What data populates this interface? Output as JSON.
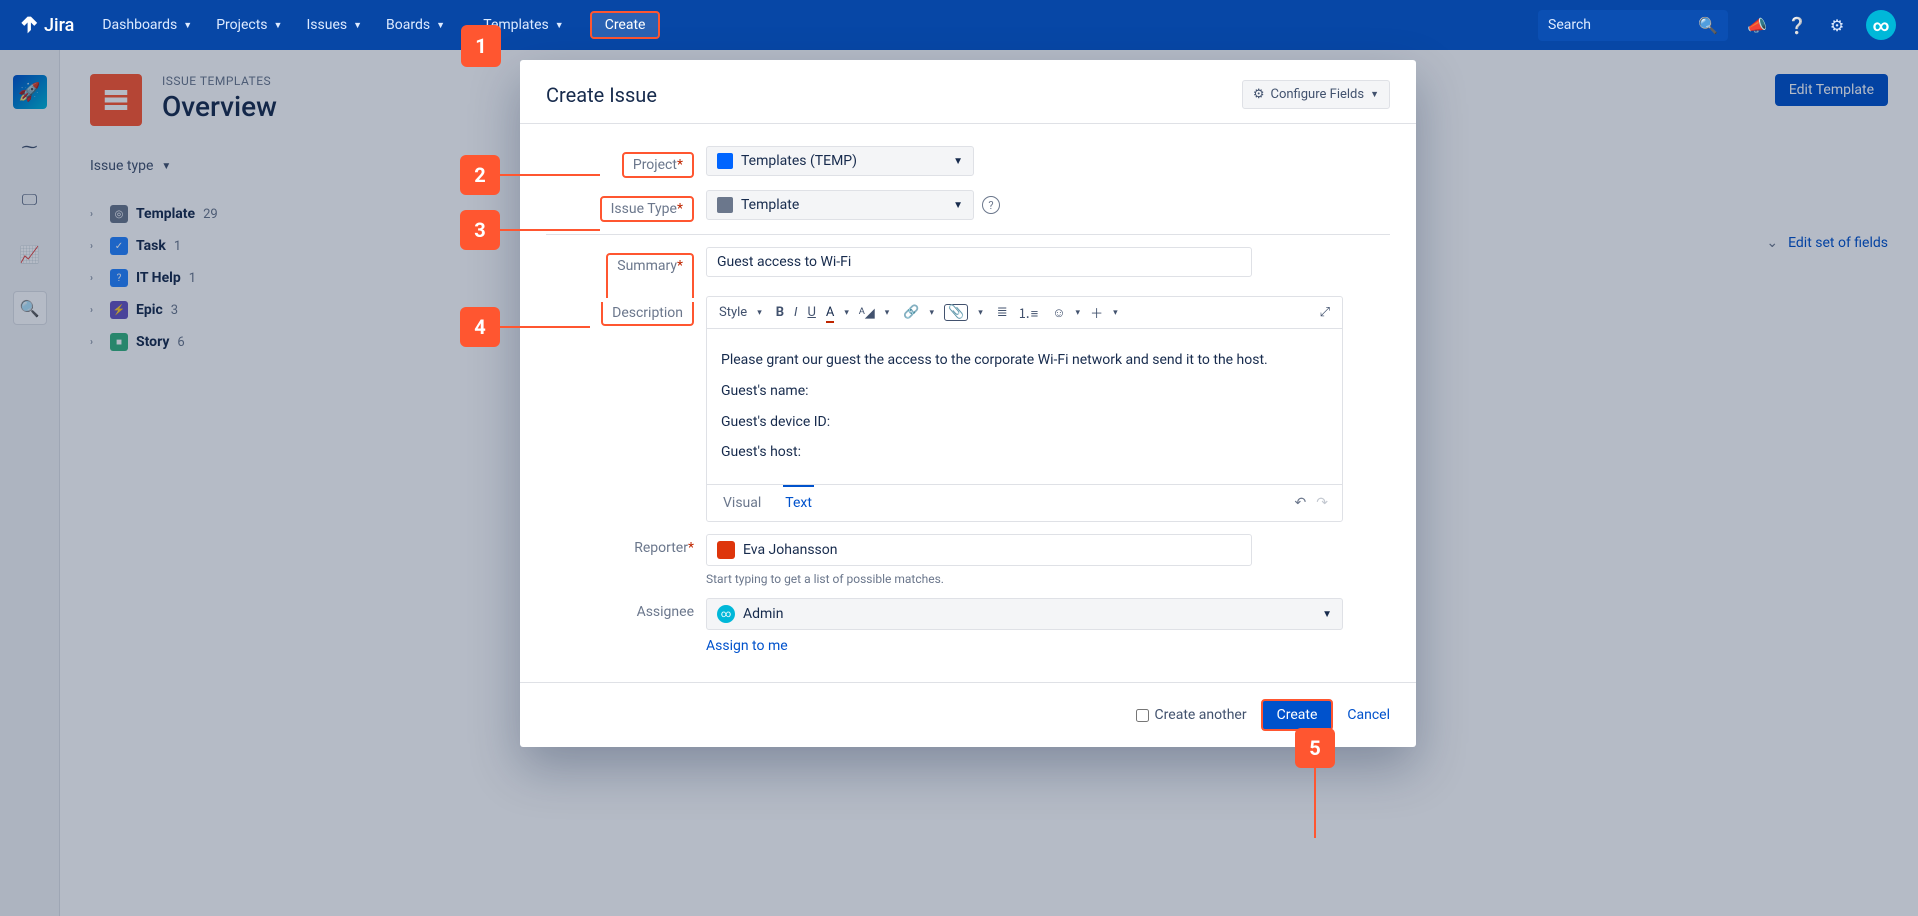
{
  "topbar": {
    "logo": "Jira",
    "items": [
      "Dashboards",
      "Projects",
      "Issues",
      "Boards",
      "... Templates"
    ],
    "create": "Create",
    "search_placeholder": "Search"
  },
  "markers": {
    "m1": "1",
    "m2": "2",
    "m3": "3",
    "m4": "4",
    "m5": "5"
  },
  "page": {
    "crumb": "ISSUE TEMPLATES",
    "title": "Overview",
    "edit_template": "Edit Template",
    "issue_type_label": "Issue type",
    "edit_fields": "Edit set of fields"
  },
  "tree": [
    {
      "name": "Template",
      "count": "29",
      "color": "#6b778c",
      "bold": true
    },
    {
      "name": "Task",
      "count": "1",
      "color": "#2684ff"
    },
    {
      "name": "IT Help",
      "count": "1",
      "color": "#2684ff"
    },
    {
      "name": "Epic",
      "count": "3",
      "color": "#6554c0"
    },
    {
      "name": "Story",
      "count": "6",
      "color": "#36b37e"
    }
  ],
  "modal": {
    "title": "Create Issue",
    "configure": "Configure Fields",
    "labels": {
      "project": "Project",
      "issue_type": "Issue Type",
      "summary": "Summary",
      "description": "Description",
      "reporter": "Reporter",
      "assignee": "Assignee"
    },
    "project_value": "Templates (TEMP)",
    "issue_type_value": "Template",
    "summary_value": "Guest access to Wi-Fi",
    "description_lines": [
      "Please grant our guest the access to the corporate Wi-Fi network and send it to the host.",
      "Guest's name:",
      "Guest's device ID:",
      "Guest's host:"
    ],
    "editor_style": "Style",
    "tabs": {
      "visual": "Visual",
      "text": "Text"
    },
    "reporter_value": "Eva Johansson",
    "reporter_hint": "Start typing to get a list of possible matches.",
    "assignee_value": "Admin",
    "assign_link": "Assign to me",
    "footer": {
      "create_another": "Create another",
      "create": "Create",
      "cancel": "Cancel"
    }
  }
}
